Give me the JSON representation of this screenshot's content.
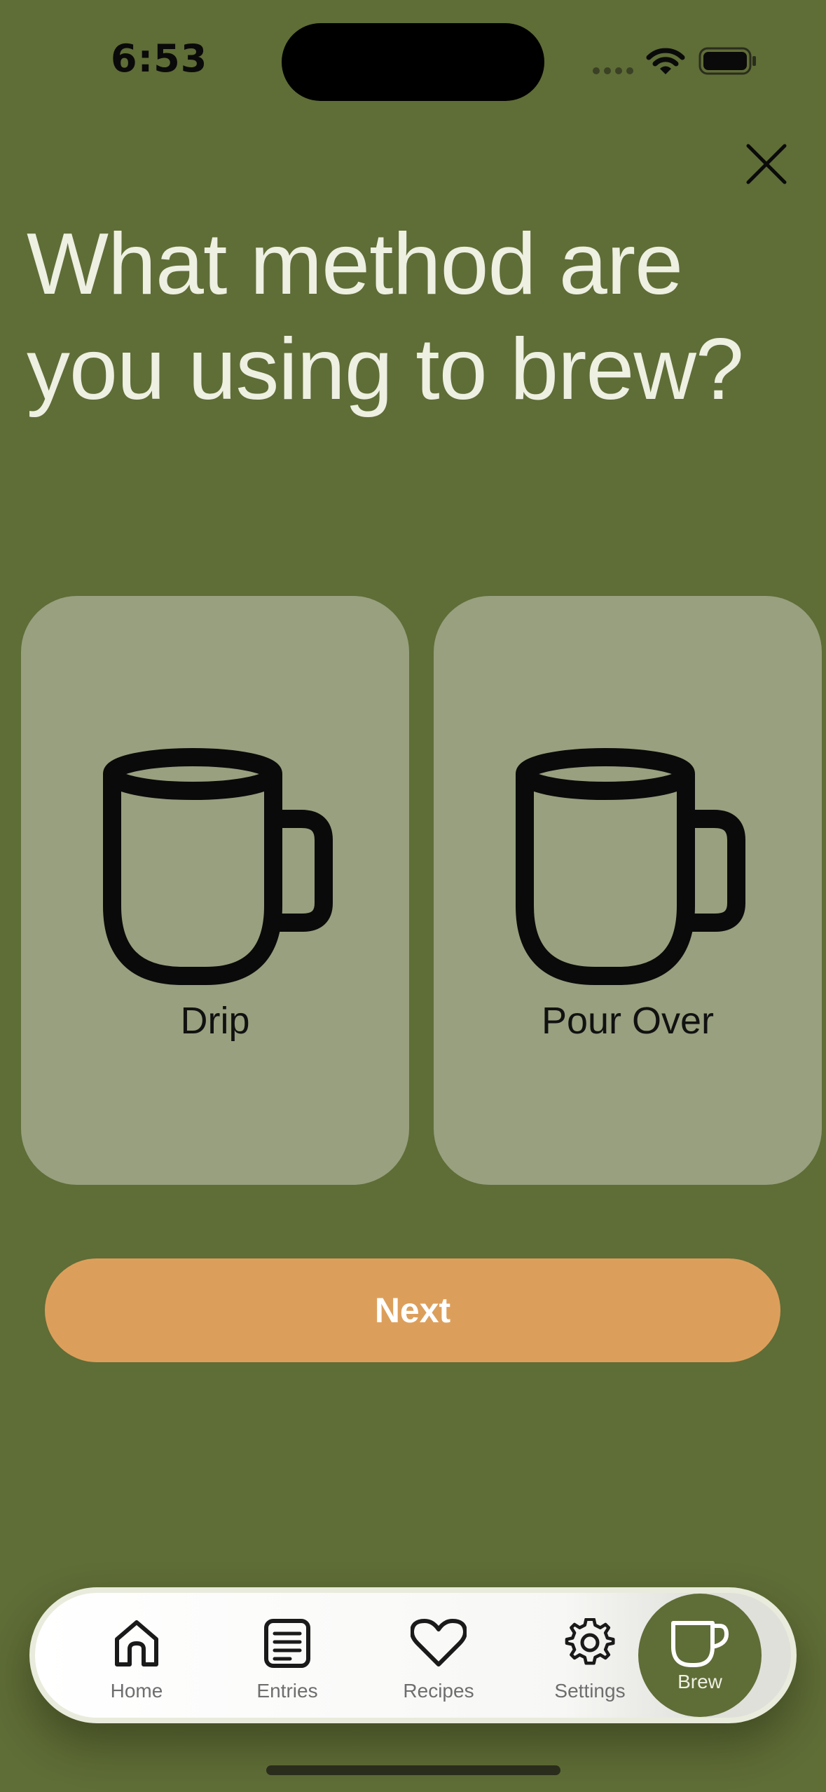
{
  "status_bar": {
    "time": "6:53"
  },
  "question": {
    "title": "What method are you using to brew?"
  },
  "options": [
    {
      "label": "Drip",
      "icon": "mug-icon",
      "selected": false
    },
    {
      "label": "Pour Over",
      "icon": "mug-icon",
      "selected": false
    }
  ],
  "next_button": {
    "label": "Next"
  },
  "tab_bar": {
    "items": [
      {
        "label": "Home",
        "icon": "house-icon"
      },
      {
        "label": "Entries",
        "icon": "document-list-icon"
      },
      {
        "label": "Recipes",
        "icon": "heart-icon"
      },
      {
        "label": "Settings",
        "icon": "gear-icon"
      },
      {
        "label": "Brew",
        "icon": "cup-icon",
        "active": true
      }
    ]
  },
  "colors": {
    "background": "#5f6d37",
    "card": "#98a07f",
    "accent_button": "#dc9f5b",
    "title_text": "#eef0e2"
  }
}
